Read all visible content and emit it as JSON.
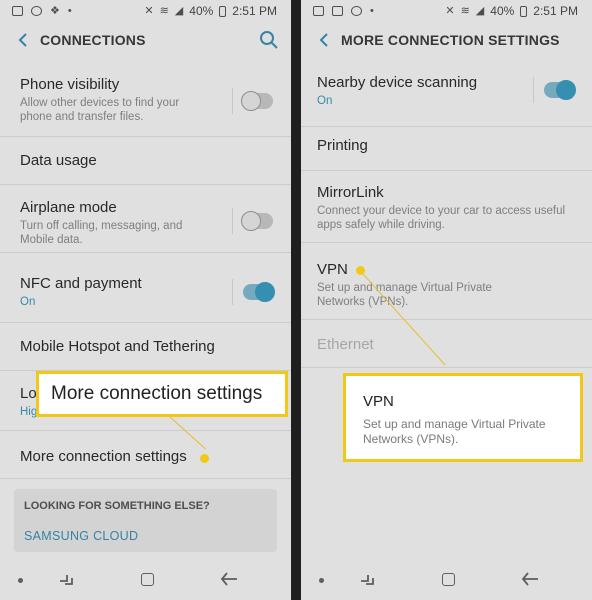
{
  "status_bar": {
    "battery": "40%",
    "time": "2:51 PM"
  },
  "left_screen": {
    "title": "CONNECTIONS",
    "rows": [
      {
        "title": "Phone visibility",
        "subtitle": "Allow other devices to find your phone and transfer files.",
        "toggle": "off"
      },
      {
        "title": "Data usage",
        "subtitle": ""
      },
      {
        "title": "Airplane mode",
        "subtitle": "Turn off calling, messaging, and Mobile data.",
        "toggle": "off"
      },
      {
        "title": "NFC and payment",
        "subtitle": "On",
        "toggle": "on"
      },
      {
        "title": "Mobile Hotspot and Tethering",
        "subtitle": ""
      },
      {
        "title": "Lo",
        "subtitle": "Hig"
      },
      {
        "title": "More connection settings",
        "subtitle": ""
      }
    ],
    "help_card": {
      "title": "LOOKING FOR SOMETHING ELSE?",
      "link": "SAMSUNG CLOUD"
    },
    "callout": {
      "title": "More connection settings"
    }
  },
  "right_screen": {
    "title": "MORE CONNECTION SETTINGS",
    "rows": [
      {
        "title": "Nearby device scanning",
        "subtitle": "On",
        "toggle": "on"
      },
      {
        "title": "Printing",
        "subtitle": ""
      },
      {
        "title": "MirrorLink",
        "subtitle": "Connect your device to your car to access useful apps safely while driving."
      },
      {
        "title": "VPN",
        "subtitle": "Set up and manage Virtual Private Networks (VPNs)."
      },
      {
        "title": "Ethernet",
        "subtitle": "",
        "disabled": true
      }
    ],
    "callout": {
      "title": "VPN",
      "subtitle": "Set up and manage Virtual Private Networks (VPNs)."
    }
  },
  "icons": {
    "back": "arrow-left-icon",
    "search": "search-icon",
    "nav_recent": "recent-apps-icon",
    "nav_home": "home-icon",
    "nav_back": "back-arrow-icon"
  },
  "colors": {
    "accent": "#3a98b9",
    "highlight": "#f2c818",
    "toggle_on": "#3a9cc0"
  }
}
